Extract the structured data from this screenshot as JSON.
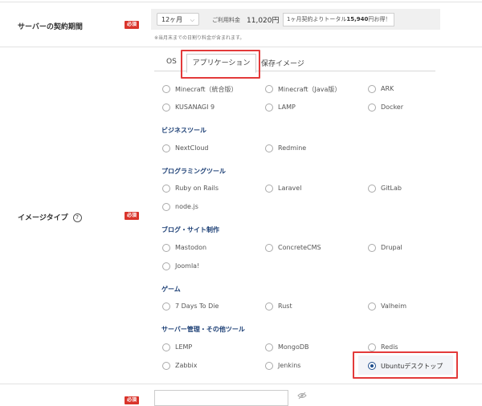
{
  "contract": {
    "label": "サーバーの契約期間",
    "required": "必須",
    "term": "12ヶ月",
    "fee_label": "ご利用料金",
    "fee_amount": "11,020円",
    "discount_pre": "1ヶ月契約よりトータル",
    "discount_amount": "15,940",
    "discount_post": "円お得！",
    "note": "※当月末までの日割り料金が含まれます。"
  },
  "image_type": {
    "label": "イメージタイプ",
    "help": "?",
    "required": "必須"
  },
  "tabs": [
    "OS",
    "アプリケーション",
    "保存イメージ"
  ],
  "apps": {
    "games_top": [
      "Minecraft（統合版）",
      "Minecraft（Java版）",
      "ARK",
      "KUSANAGI 9",
      "LAMP",
      "Docker"
    ],
    "business_title": "ビジネスツール",
    "business": [
      "NextCloud",
      "Redmine"
    ],
    "programming_title": "プログラミングツール",
    "programming": [
      "Ruby on Rails",
      "Laravel",
      "GitLab",
      "node.js"
    ],
    "blog_title": "ブログ・サイト制作",
    "blog": [
      "Mastodon",
      "ConcreteCMS",
      "Drupal",
      "Joomla!"
    ],
    "game_title": "ゲーム",
    "game": [
      "7 Days To Die",
      "Rust",
      "Valheim"
    ],
    "server_title": "サーバー管理・その他ツール",
    "server": [
      "LEMP",
      "MongoDB",
      "Redis",
      "Zabbix",
      "Jenkins",
      "Ubuntuデスクトップ"
    ]
  },
  "selected": "Ubuntuデスクトップ",
  "bottom_required": "必須",
  "colors": {
    "accent": "#e33a3a",
    "required": "#d9342b",
    "category": "#1c3f75"
  }
}
